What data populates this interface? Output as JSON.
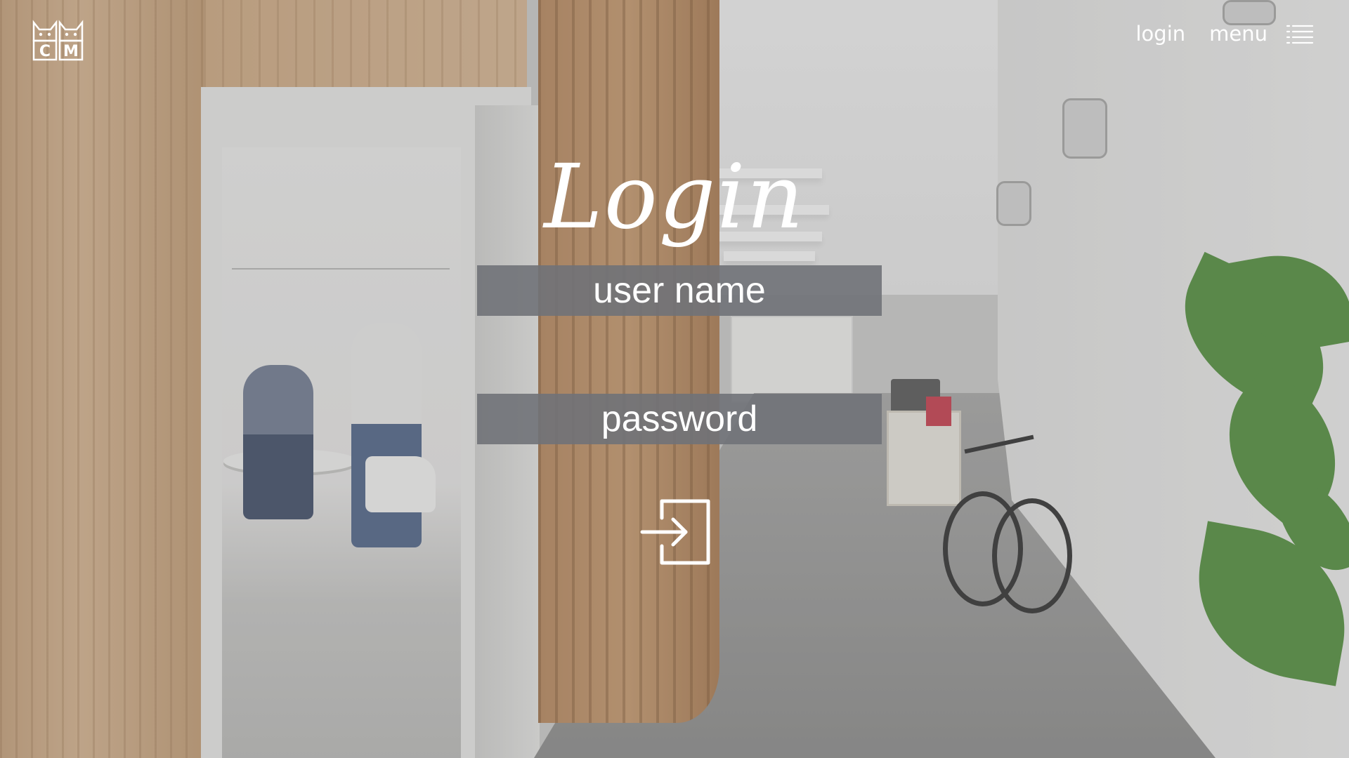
{
  "header": {
    "logo_letters": [
      "C",
      "M"
    ],
    "login_link": "login",
    "menu_link": "menu",
    "menu_icon": "list-icon"
  },
  "main": {
    "title": "Login",
    "username_placeholder": "user name",
    "password_placeholder": "password",
    "submit_icon": "sign-in-icon"
  },
  "colors": {
    "field_background": "#707278",
    "text": "#ffffff",
    "overlay": "#787878"
  }
}
